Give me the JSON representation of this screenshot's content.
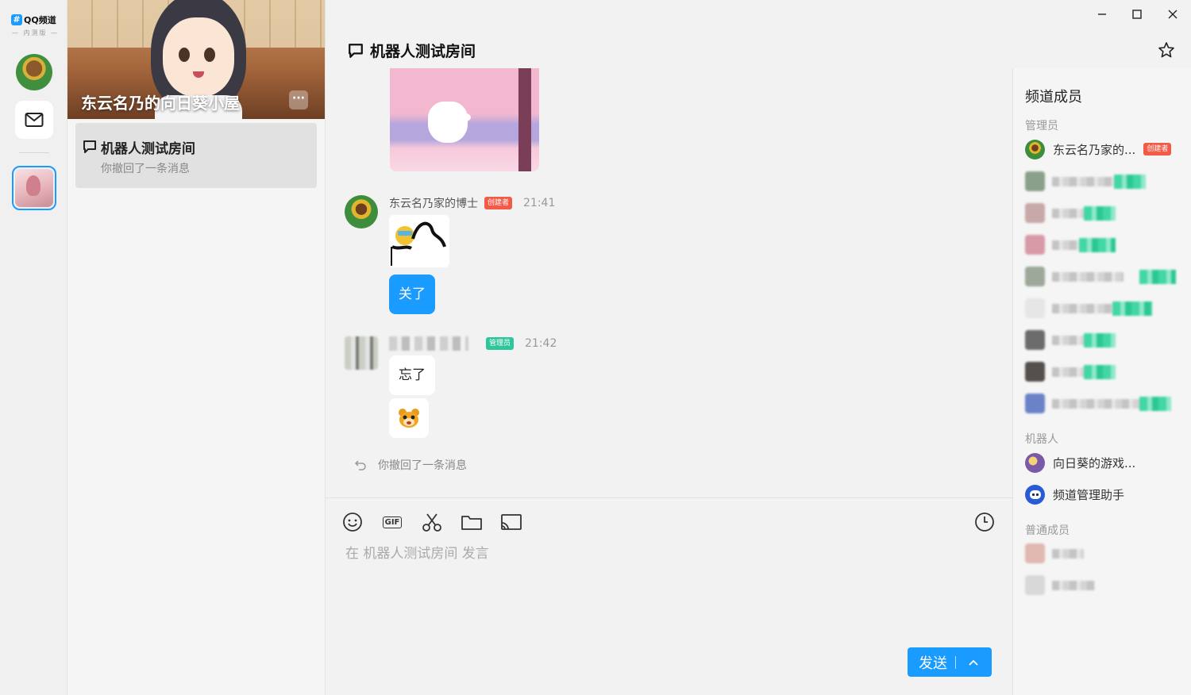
{
  "app": {
    "logo_text": "QQ频道",
    "logo_sub": "— 内测版 —"
  },
  "guild": {
    "name": "东云名乃的向日葵小屋",
    "more_label": "···"
  },
  "channel_list": [
    {
      "name": "机器人测试房间",
      "preview": "你撤回了一条消息"
    }
  ],
  "room": {
    "title": "机器人测试房间"
  },
  "messages": [
    {
      "sender": "东云名乃家的博士",
      "role_badge": "创建者",
      "time": "21:41",
      "items": [
        "sticker",
        "关了"
      ]
    },
    {
      "sender": "",
      "role_badge": "管理员",
      "time": "21:42",
      "items": [
        "忘了",
        "emoji"
      ]
    }
  ],
  "recall_notice": "你撤回了一条消息",
  "composer": {
    "placeholder": "在 机器人测试房间 发言",
    "send_label": "发送",
    "gif_label": "GIF",
    "tools": [
      "smile-icon",
      "gif-icon",
      "scissors-icon",
      "folder-icon",
      "screen-share-icon",
      "clock-icon"
    ]
  },
  "members": {
    "title": "频道成员",
    "sections": {
      "admins": "管理员",
      "bots": "机器人",
      "regular": "普通成员"
    },
    "owner": {
      "name": "东云名乃家的...",
      "badge": "创建者"
    },
    "bots": [
      {
        "name": "向日葵的游戏..."
      },
      {
        "name": "频道管理助手"
      }
    ]
  },
  "colors": {
    "accent": "#1a9bff",
    "owner_badge": "#f35b46",
    "admin_badge": "#2ec69a"
  }
}
